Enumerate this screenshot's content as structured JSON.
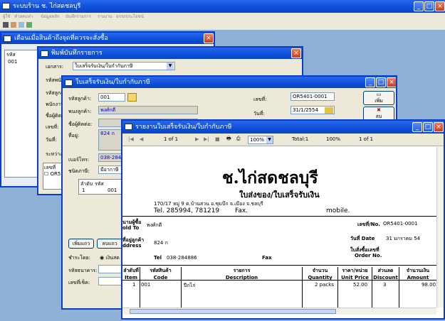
{
  "app": {
    "title": "ระบบร้าน ช. ไก่สดชลบุรี",
    "menu": [
      "ผู้ใช้",
      "ทำสคแท่า",
      "ข้อมูลหลัก",
      "บันทึกรายการ",
      "รายงาน",
      "อรรถประโยชน์"
    ]
  },
  "w1": {
    "title": "เตือนเมื่อสินค้าถึงจุดที่ควรจะสั่งซื้อ",
    "col": "รหัส",
    "row": "001"
  },
  "w2": {
    "title": "พิมพ์บันทึกรายการ",
    "doc_label": "เอกสาร:",
    "doc_value": "ใบเสร็จรับเงิน/ใบกำกับภาษี",
    "l1": "รหัสพนัก",
    "l2": "รหัสลูกค้า",
    "l3": "พนักงาน",
    "l4": "ชื่อผู้ติดต่อ",
    "l5": "เลขที่:",
    "l6": "วันที่:",
    "l7": "ระหว่าง",
    "sub": "เลขที่",
    "item": "OR5"
  },
  "w3": {
    "title": "ใบเสร็จรับเงิน/ใบกำกับภาษี",
    "cust_label": "รหัสลูกค้า:",
    "cust_value": "001",
    "emp_label": "พนงลูกค้า:",
    "emp_value": "พงศ์กดี",
    "contact_label": "ชื่อผู้ติดต่อ:",
    "addr_label": "ที่อยู่:",
    "addr_value": "824 ก",
    "phone_label": "เบอร์โทร:",
    "phone_value": "038-28488",
    "tax_label": "ชนิดภาษี:",
    "tax_value": "มีอากาษี",
    "no_label": "เลขที่:",
    "no_value": "OR5401-0001",
    "date_label": "วันที่:",
    "date_value": "31/1/2554",
    "add_btn": "เพิ่ม",
    "del_btn": "ลบ",
    "grid_h1": "ลำดับ",
    "grid_h2": "รหัส",
    "grid_r1": "1",
    "grid_r2": "001",
    "btn_add": "เพิ่มแถว",
    "btn_del": "ลบแถว",
    "pay_label": "ชำระโดย:",
    "pay_option": "เงินสด",
    "bank_label": "รหัสธนาคาร:",
    "cheque_label": "เลขที่เช็ค:"
  },
  "rep": {
    "title": "รายงานใบเสร็จรับเงิน/ใบกำกับภาษี",
    "page": "1 of 1",
    "zoom": "100%",
    "total": "Total:1",
    "pct": "100%",
    "count": "1 of 1",
    "shop": "ช.ไก่สดชลบุรี",
    "doc": "ใบส่งของ/ใบเสร็จรับเงิน",
    "addr": "170/17 หมู่ 9 ต.บ้านสวน อ.ซุมบึก จ.เมือง จ.ชลบุรี",
    "tel": "Tel. 285994, 781219",
    "fax": "Fax.",
    "mobile": "mobile.",
    "soldto_th": "นามผู้ซื้อ",
    "soldto": "old To",
    "cust_name": "พงศ์กดี",
    "no_label": "เลขที่/No.",
    "no_value": "OR5401-0001",
    "addr_th": "ที่อยู่ลูกค้า",
    "addr_en": "ddress",
    "addr_value": "824 ก",
    "date_label": "วันที่ Date",
    "date_value": "31 มกราคม 54",
    "order_th": "ใบสั่งซื้อเลขที่",
    "order_en": "Order No.",
    "tel2_label": "Tel",
    "tel2": "038-284886",
    "fax2": "Fax",
    "cols": [
      {
        "th": "ลำดับที่",
        "en": "Item"
      },
      {
        "th": "รหัสสินค้า",
        "en": "Code"
      },
      {
        "th": "รายการ",
        "en": "Description"
      },
      {
        "th": "จำนวน",
        "en": "Quantity"
      },
      {
        "th": "ราคา/หน่วย",
        "en": "Unit Price"
      },
      {
        "th": "ส่วนลด",
        "en": "Discount"
      },
      {
        "th": "จำนวนเงิน",
        "en": "Amount"
      }
    ],
    "row": [
      "1",
      "001",
      "ปีกไก่",
      "2 packs",
      "52.00",
      "3",
      "98.00"
    ]
  }
}
